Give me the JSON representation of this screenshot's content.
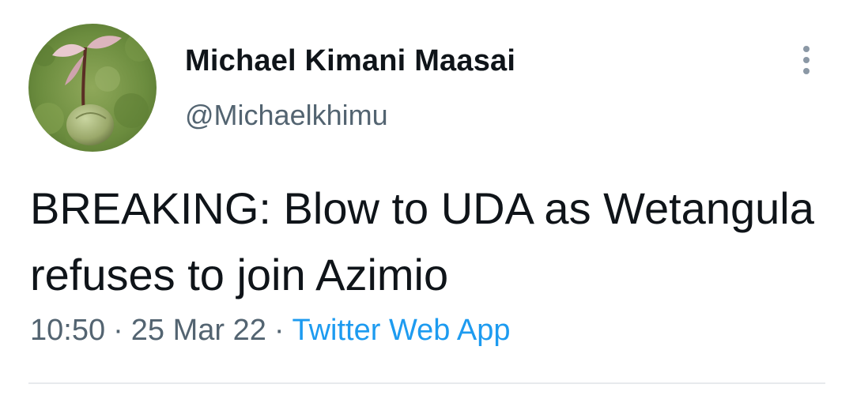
{
  "tweet": {
    "author": {
      "display_name": "Michael Kimani Maasai",
      "handle": "@Michaelkhimu"
    },
    "text": "BREAKING: Blow to UDA as Wetangula refuses to join Azimio",
    "time": "10:50",
    "separator": "·",
    "date": "25 Mar 22",
    "source": "Twitter Web App"
  },
  "icons": {
    "avatar": "avatar-photo-seedling",
    "more": "more-vertical-icon"
  },
  "colors": {
    "text": "#0f1419",
    "secondary": "#536471",
    "link": "#1d9bf0",
    "divider": "#e7eaed"
  }
}
